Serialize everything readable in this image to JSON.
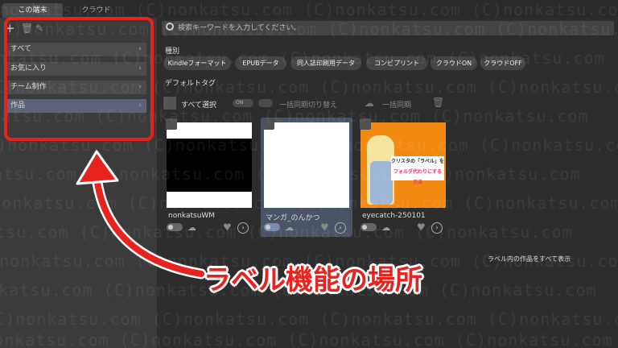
{
  "tabs": [
    {
      "label": "この端末"
    },
    {
      "label": "クラウド"
    }
  ],
  "sidebar": {
    "items": [
      {
        "label": "すべて"
      },
      {
        "label": "お気に入り"
      },
      {
        "label": "チーム制作"
      },
      {
        "label": "作品"
      }
    ]
  },
  "search": {
    "placeholder": "検索キーワードを入力してください。"
  },
  "filters": {
    "type_label": "種別",
    "tags": [
      "Kindleフォーマット",
      "EPUBデータ",
      "同人誌印刷用データ",
      "コンビプリント",
      "クラウドON",
      "クラウドOFF"
    ],
    "default_tag_label": "デフォルトタグ"
  },
  "selection_bar": {
    "select_all": "すべて選択",
    "toggle_on": "ON",
    "sync_label": "一括同期切り替え",
    "bulk_sync": "一括同期"
  },
  "cards": [
    {
      "title": "nonkatsuWM"
    },
    {
      "title": "マンガ_のんかつ"
    },
    {
      "title": "eyecatch-250101",
      "thumb_text_line1": "クリスタの「ラベル」を",
      "thumb_text_line2": "フォルダ代わりにする方法"
    }
  ],
  "show_all_label": "ラベル内の作品をすべて表示",
  "annotation": {
    "text": "ラベル機能の場所"
  },
  "watermark": {
    "text": "(C)nonkatsu.com (C)nonkatsu.com (C)nonkatsu.com (C)nonkatsu.com"
  },
  "colors": {
    "highlight_red": "#e8231f",
    "selected_item": "#5b6479",
    "orange_thumb": "#f28a12"
  }
}
